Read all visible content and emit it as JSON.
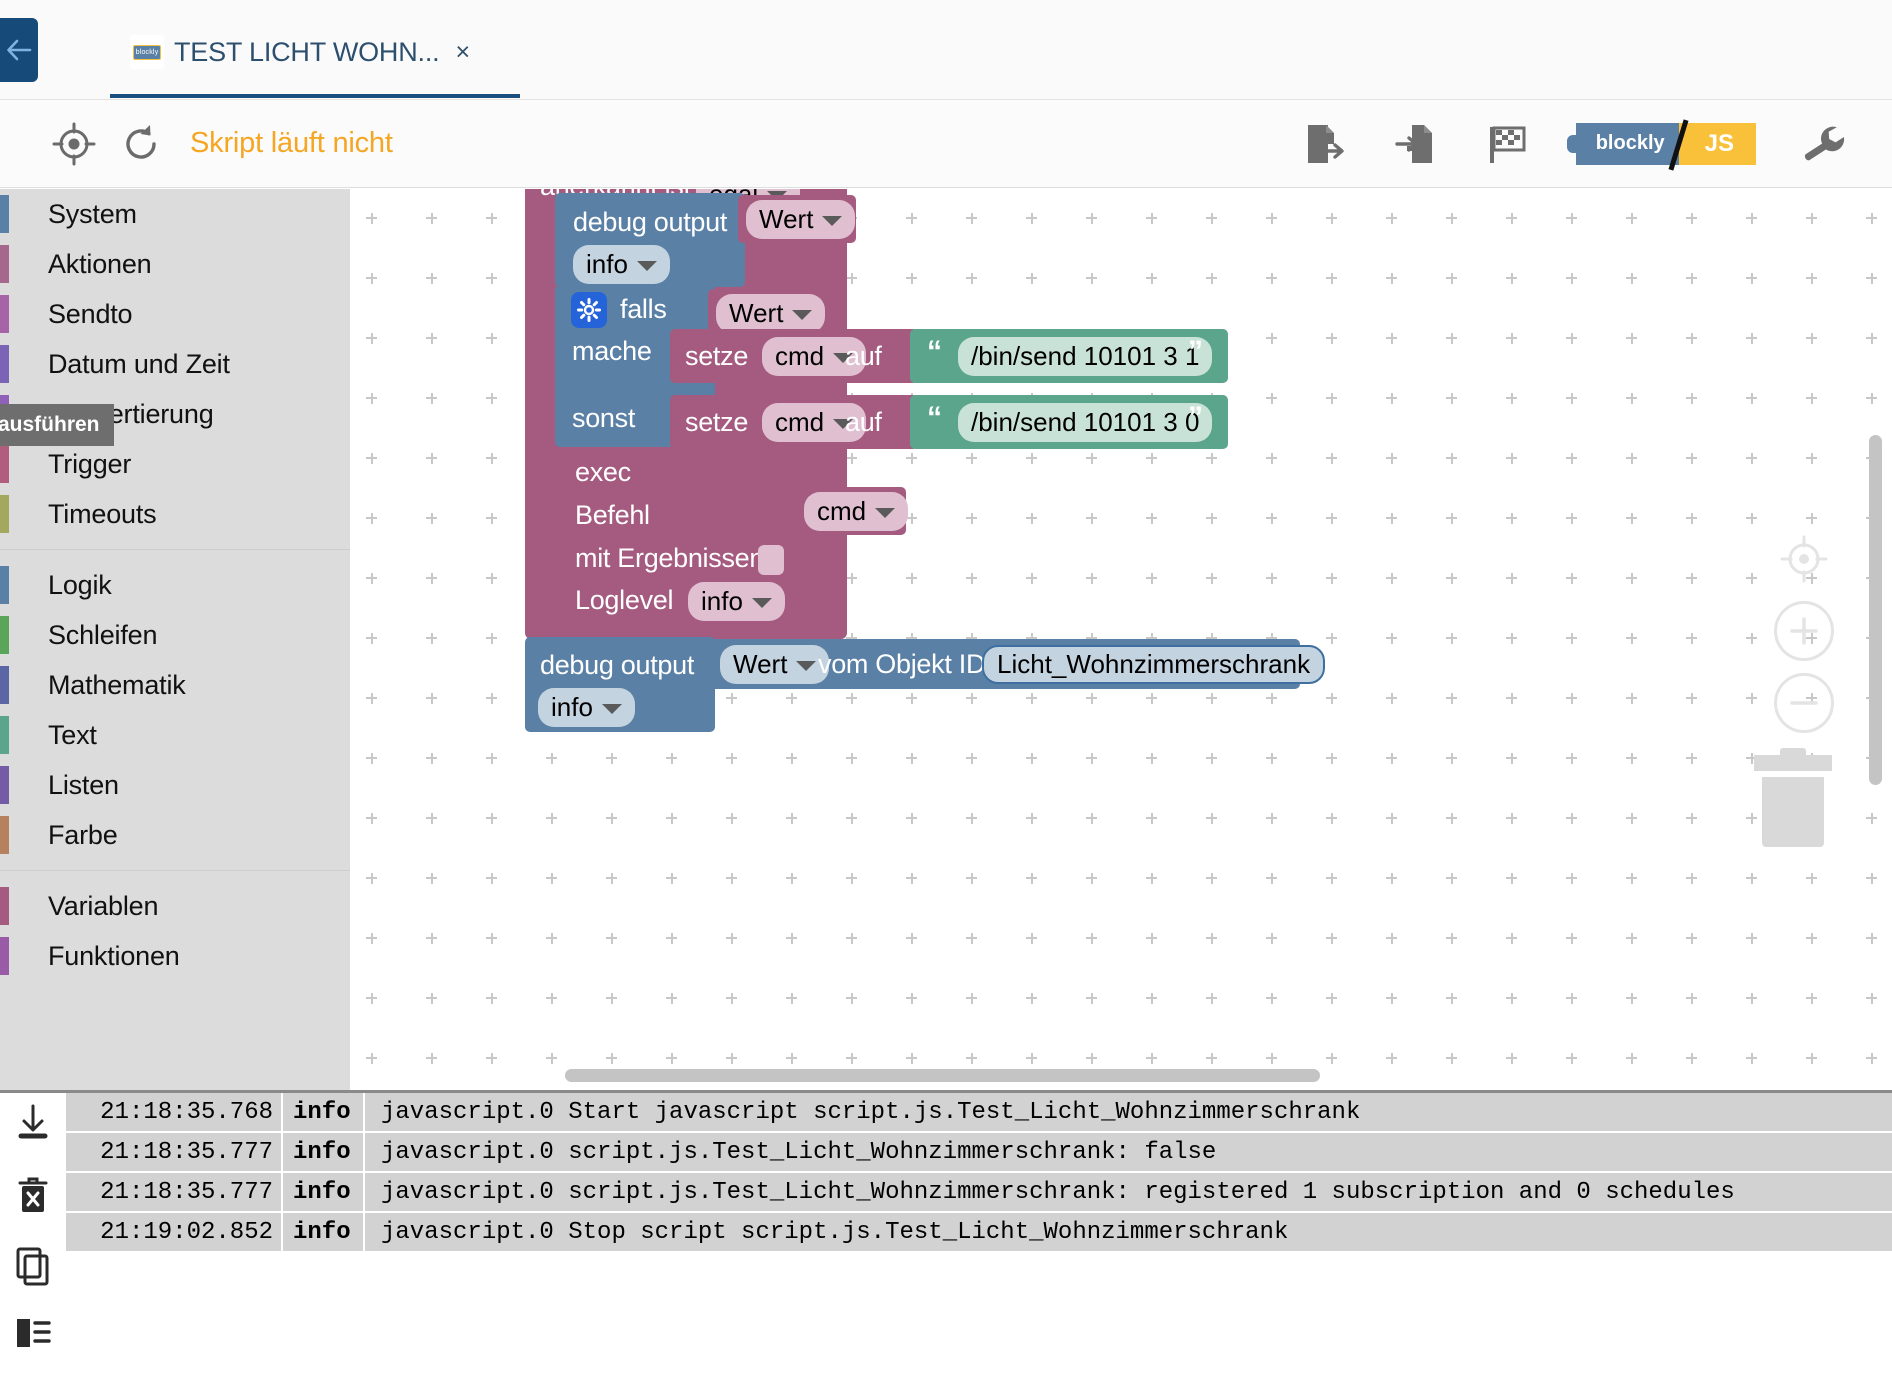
{
  "window": {
    "back_button_label": "back",
    "tab": {
      "title": "TEST LICHT WOHN...",
      "favicon_label": "blockly",
      "close_label": "×"
    }
  },
  "toolbar": {
    "locate_icon": "crosshair-target-icon",
    "reload_icon": "refresh-icon",
    "status_text": "Skript läuft nicht",
    "export_icon": "export-blocks-icon",
    "import_icon": "import-blocks-icon",
    "checkered_flag_icon": "checkered-flag-icon",
    "blockly_label": "blockly",
    "js_label": "JS",
    "settings_icon": "wrench-icon"
  },
  "tooltip": {
    "text": "ausführen"
  },
  "sidebar": {
    "groups": [
      {
        "items": [
          {
            "label": "System",
            "color": "#5b80a5"
          },
          {
            "label": "Aktionen",
            "color": "#a5678b"
          },
          {
            "label": "Sendto",
            "color": "#a763a7"
          },
          {
            "label": "Datum und Zeit",
            "color": "#7b63b5"
          },
          {
            "label": "Konvertierung",
            "color": "#9061b8"
          },
          {
            "label": "Trigger",
            "color": "#b05d7e"
          },
          {
            "label": "Timeouts",
            "color": "#a3a85e"
          }
        ]
      },
      {
        "items": [
          {
            "label": "Logik",
            "color": "#5b80a5"
          },
          {
            "label": "Schleifen",
            "color": "#5ba55b"
          },
          {
            "label": "Mathematik",
            "color": "#5b67a5"
          },
          {
            "label": "Text",
            "color": "#5ba58c"
          },
          {
            "label": "Listen",
            "color": "#745ba5"
          },
          {
            "label": "Farbe",
            "color": "#b5815e"
          }
        ]
      },
      {
        "items": [
          {
            "label": "Variablen",
            "color": "#a55b80"
          },
          {
            "label": "Funktionen",
            "color": "#995ba5"
          }
        ]
      }
    ]
  },
  "workspace": {
    "blocks": {
      "trigger_header": {
        "prefix_text": "anerkannt ist",
        "dropdown_value": "egal"
      },
      "debug_output_1": {
        "label": "debug output",
        "severity": "info",
        "value_dropdown": "Wert"
      },
      "if_block": {
        "gear_icon": "gear-icon",
        "if_label": "falls",
        "condition_dropdown": "Wert",
        "do_label": "mache",
        "else_label": "sonst"
      },
      "set_cmd_if": {
        "set_label": "setze",
        "variable": "cmd",
        "to_label": "auf",
        "text_value": "/bin/send 10101 3 1"
      },
      "set_cmd_else": {
        "set_label": "setze",
        "variable": "cmd",
        "to_label": "auf",
        "text_value": "/bin/send 10101 3 0"
      },
      "exec_block": {
        "title": "exec",
        "command_label": "Befehl",
        "command_value": "cmd",
        "results_label": "mit Ergebnissen",
        "results_checked": false,
        "loglevel_label": "Loglevel",
        "loglevel_value": "info"
      },
      "debug_output_2": {
        "label": "debug output",
        "value_dropdown": "Wert",
        "object_label": "vom Objekt ID",
        "object_id": "Licht_Wohnzimmerschrank",
        "severity": "info"
      }
    },
    "controls": {
      "center_icon": "center-workspace-icon",
      "zoom_in_icon": "zoom-in-icon",
      "zoom_out_icon": "zoom-out-icon",
      "trash_icon": "trash-icon"
    },
    "colors": {
      "trigger": "#a55b80",
      "debug": "#5b80a5",
      "text": "#5ba58c",
      "field_light": "#e0c0d0"
    }
  },
  "log": {
    "side_icons": [
      "download-icon",
      "clear-log-icon",
      "copy-icon",
      "toggle-layout-icon"
    ],
    "rows": [
      {
        "time": "21:18:35.768",
        "severity": "info",
        "message": "javascript.0 Start javascript script.js.Test_Licht_Wohnzimmerschrank"
      },
      {
        "time": "21:18:35.777",
        "severity": "info",
        "message": "javascript.0 script.js.Test_Licht_Wohnzimmerschrank: false"
      },
      {
        "time": "21:18:35.777",
        "severity": "info",
        "message": "javascript.0 script.js.Test_Licht_Wohnzimmerschrank: registered 1 subscription and 0 schedules"
      },
      {
        "time": "21:19:02.852",
        "severity": "info",
        "message": "javascript.0 Stop script script.js.Test_Licht_Wohnzimmerschrank"
      }
    ]
  }
}
